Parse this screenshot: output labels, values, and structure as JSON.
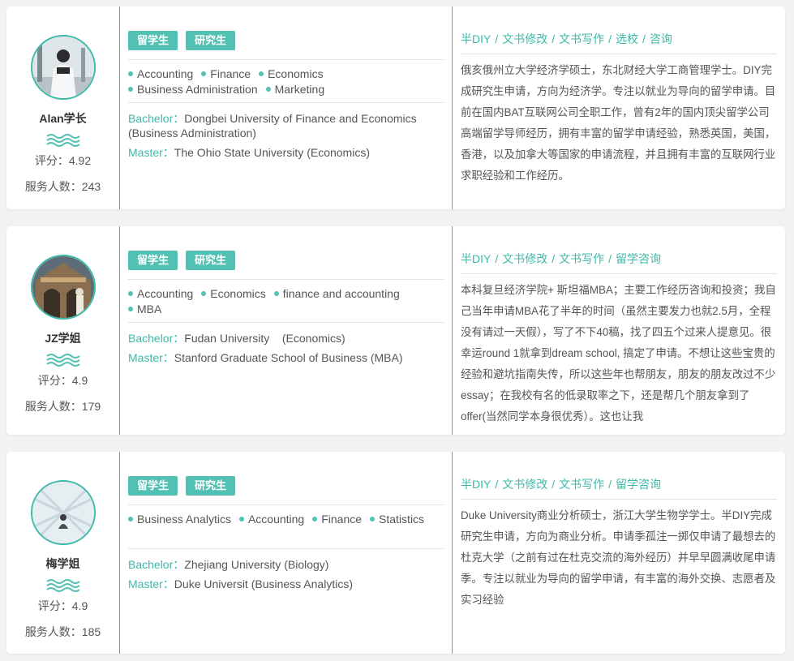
{
  "mentors": [
    {
      "name": "Alan学长",
      "score": "评分：4.92",
      "served": "服务人数：243",
      "badges": [
        "留学生",
        "研究生"
      ],
      "tags": [
        "Accounting",
        "Finance",
        "Economics",
        "Business Administration",
        "Marketing"
      ],
      "bachelor_label": "Bachelor：",
      "bachelor": "Dongbei University of Finance and Economics  (Business Administration)",
      "master_label": "Master：",
      "master": "The Ohio State University  (Economics)",
      "services": [
        "半DIY",
        "文书修改",
        "文书写作",
        "选校",
        "咨询"
      ],
      "bio": "俄亥俄州立大学经济学硕士，东北财经大学工商管理学士。DIY完成研究生申请，方向为经济学。专注以就业为导向的留学申请。目前在国内BAT互联网公司全职工作，曾有2年的国内顶尖留学公司高端留学导师经历，拥有丰富的留学申请经验，熟悉英国，美国，香港，以及加拿大等国家的申请流程，并且拥有丰富的互联网行业求职经验和工作经历。"
    },
    {
      "name": "JZ学姐",
      "score": "评分：4.9",
      "served": "服务人数：179",
      "badges": [
        "留学生",
        "研究生"
      ],
      "tags": [
        "Accounting",
        "Economics",
        "finance and accounting",
        "MBA"
      ],
      "bachelor_label": "Bachelor：",
      "bachelor": "Fudan University    (Economics)",
      "master_label": "Master：",
      "master": "Stanford Graduate School of Business  (MBA)",
      "services": [
        "半DIY",
        "文书修改",
        "文书写作",
        "留学咨询"
      ],
      "bio": "本科复旦经济学院+ 斯坦福MBA；主要工作经历咨询和投资；我自己当年申请MBA花了半年的时间（虽然主要发力也就2.5月，全程没有请过一天假），写了不下40稿，找了四五个过来人提意见。很幸运round 1就拿到dream school, 搞定了申请。不想让这些宝贵的经验和避坑指南失传，所以这些年也帮朋友，朋友的朋友改过不少essay；在我校有名的低录取率之下，还是帮几个朋友拿到了offer(当然同学本身很优秀）。这也让我"
    },
    {
      "name": "梅学姐",
      "score": "评分：4.9",
      "served": "服务人数：185",
      "badges": [
        "留学生",
        "研究生"
      ],
      "tags": [
        "Business Analytics",
        "Accounting",
        "Finance",
        "Statistics"
      ],
      "bachelor_label": "Bachelor：",
      "bachelor": "Zhejiang University  (Biology)",
      "master_label": "Master：",
      "master": "Duke Universit  (Business Analytics)",
      "services": [
        "半DIY",
        "文书修改",
        "文书写作",
        "留学咨询"
      ],
      "bio": "Duke University商业分析硕士，浙江大学生物学学士。半DIY完成研究生申请，方向为商业分析。申请季孤注一掷仅申请了最想去的杜克大学（之前有过在杜克交流的海外经历）并早早圆满收尾申请季。专注以就业为导向的留学申请，有丰富的海外交换、志愿者及实习经验"
    }
  ],
  "colors": {
    "accent": "#3db9a8",
    "badge": "#52c0b2",
    "background": "#f2f2f2"
  }
}
